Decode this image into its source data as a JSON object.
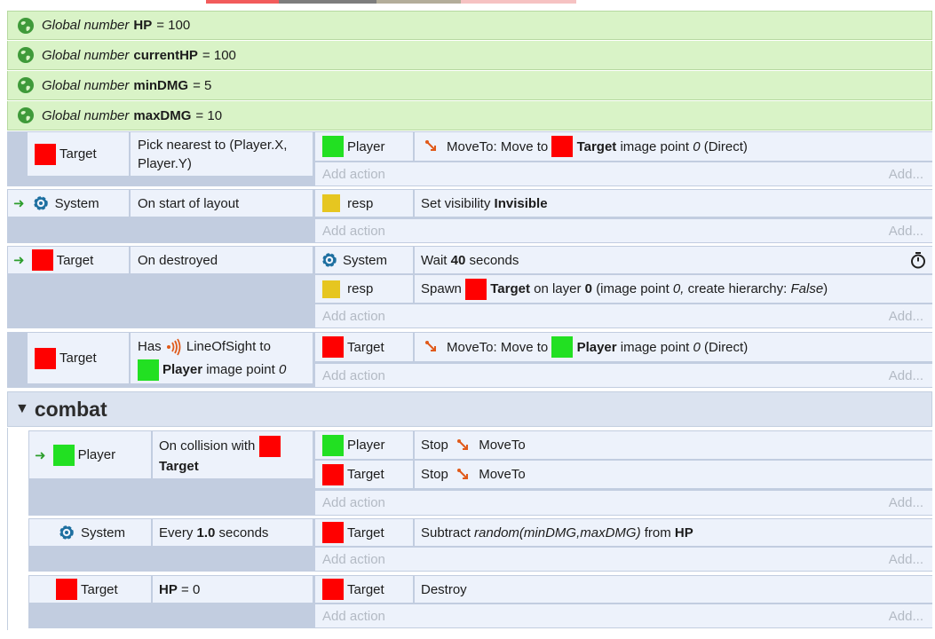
{
  "globals": [
    {
      "kw": "Global number",
      "name": "HP",
      "val": "= 100"
    },
    {
      "kw": "Global number",
      "name": "currentHP",
      "val": "= 100"
    },
    {
      "kw": "Global number",
      "name": "minDMG",
      "val": "= 5"
    },
    {
      "kw": "Global number",
      "name": "maxDMG",
      "val": "= 10"
    }
  ],
  "common": {
    "add_action": "Add action",
    "add": "Add..."
  },
  "e1": {
    "obj": "Target",
    "cond": "Pick nearest to (Player.X, Player.Y)",
    "a_obj": "Player",
    "a_pre": "MoveTo: Move to",
    "a_tgt": "Target",
    "a_post": "image point",
    "a_n": "0",
    "a_tail": "(Direct)"
  },
  "e2": {
    "obj": "System",
    "cond": "On start of layout",
    "a_obj": "resp",
    "a_pre": "Set visibility",
    "a_val": "Invisible"
  },
  "e3": {
    "obj": "Target",
    "cond": "On destroyed",
    "a1_obj": "System",
    "a1_pre": "Wait",
    "a1_val": "40",
    "a1_post": "seconds",
    "a2_obj": "resp",
    "a2_pre": "Spawn",
    "a2_tgt": "Target",
    "a2_mid": "on layer",
    "a2_n": "0",
    "a2_p1": "(image point",
    "a2_pn": "0,",
    "a2_p2": "create hierarchy:",
    "a2_f": "False",
    "a2_end": ")"
  },
  "e4": {
    "obj": "Target",
    "has": "Has",
    "los": "LineOfSight to",
    "tgt": "Player",
    "tail": "image point",
    "n": "0",
    "a_obj": "Target",
    "a_pre": "MoveTo: Move to",
    "a_tgt": "Player",
    "a_post": "image point",
    "a_n": "0",
    "a_tail": "(Direct)"
  },
  "group": {
    "name": "combat"
  },
  "e5": {
    "obj": "Player",
    "cond": "On collision with",
    "tgt": "Target",
    "a1_obj": "Player",
    "a1_pre": "Stop",
    "a1_b": "MoveTo",
    "a2_obj": "Target",
    "a2_pre": "Stop",
    "a2_b": "MoveTo"
  },
  "e6": {
    "obj": "System",
    "c_pre": "Every",
    "c_val": "1.0",
    "c_post": "seconds",
    "a_obj": "Target",
    "a_pre": "Subtract",
    "a_expr": "random(minDMG,maxDMG)",
    "a_mid": "from",
    "a_var": "HP"
  },
  "e7": {
    "obj": "Target",
    "c_var": "HP",
    "c_rest": "= 0",
    "a_obj": "Target",
    "a_act": "Destroy"
  },
  "colors": {
    "global_bg": "#d9f3c7",
    "event_bg": "#edf2fb",
    "block_bg": "#c2cde0",
    "red": "#ff0000",
    "green": "#22e022",
    "yellow": "#e6c620"
  }
}
